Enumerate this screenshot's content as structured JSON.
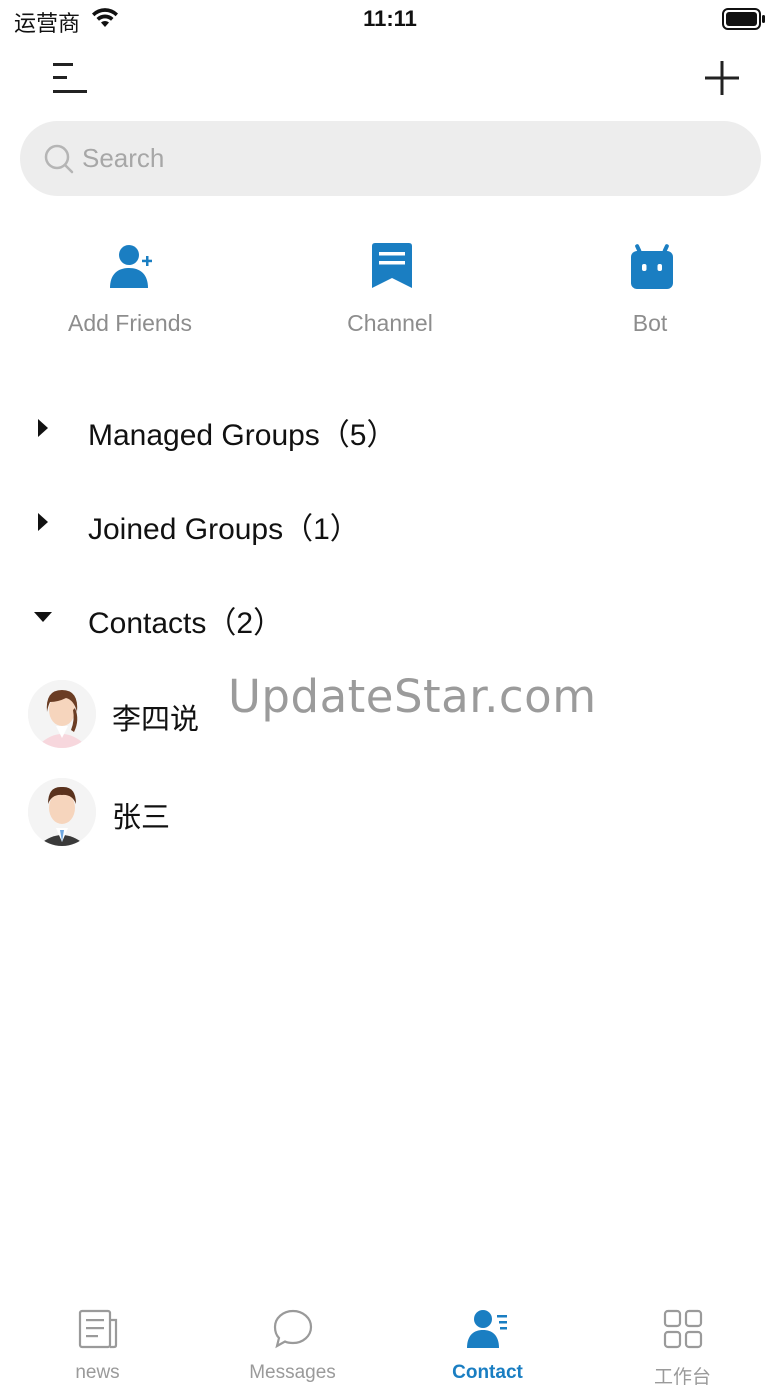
{
  "status_bar": {
    "carrier": "运营商",
    "time": "11:11"
  },
  "nav": {
    "menu_icon": "menu-lines-icon",
    "add_icon": "plus-icon"
  },
  "search": {
    "placeholder": "Search"
  },
  "quick_actions": [
    {
      "label": "Add Friends",
      "icon": "add-friend-icon"
    },
    {
      "label": "Channel",
      "icon": "channel-icon"
    },
    {
      "label": "Bot",
      "icon": "bot-icon"
    }
  ],
  "groups": [
    {
      "label": "Managed Groups（5）",
      "expanded": false
    },
    {
      "label": "Joined Groups（1）",
      "expanded": false
    },
    {
      "label": "Contacts（2）",
      "expanded": true
    }
  ],
  "contacts": [
    {
      "name": "李四说",
      "avatar": "female-avatar"
    },
    {
      "name": "张三",
      "avatar": "male-avatar"
    }
  ],
  "watermark": "UpdateStar.com",
  "tabs": [
    {
      "label": "news",
      "icon": "news-icon",
      "active": false
    },
    {
      "label": "Messages",
      "icon": "chat-bubble-icon",
      "active": false
    },
    {
      "label": "Contact",
      "icon": "contact-icon",
      "active": true
    },
    {
      "label": "工作台",
      "icon": "grid-icon",
      "active": false
    }
  ],
  "colors": {
    "accent": "#1a7ec2",
    "search_bg": "#ededed",
    "muted_text": "#8d8d8d"
  }
}
